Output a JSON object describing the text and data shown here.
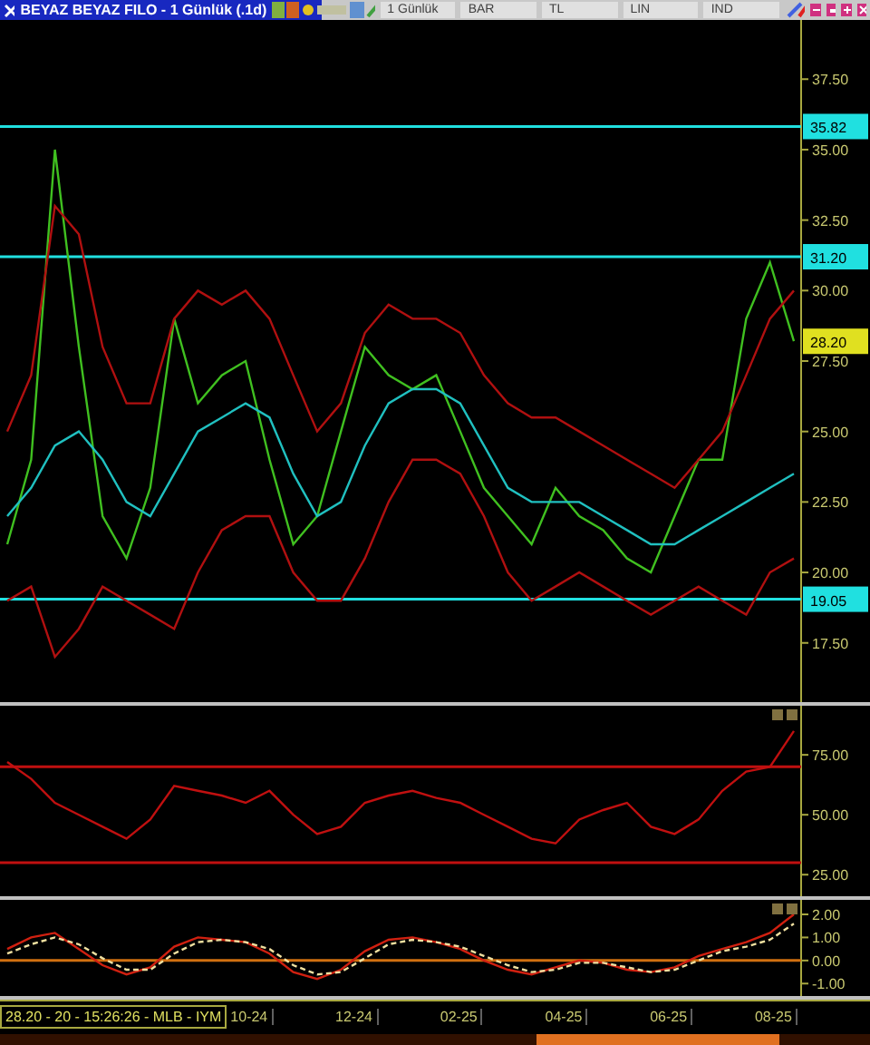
{
  "window": {
    "title": "BEYAZ BEYAZ FILO - 1 Günlük (.1d)"
  },
  "toolbar": [
    "1 Günlük",
    "BAR",
    "TL",
    "LIN",
    "IND"
  ],
  "panels": [
    {
      "chart_data": {
        "type": "line",
        "ylim": [
          15.4,
          39.6
        ],
        "yticks": [
          {
            "value": 17.5,
            "label": "17.50"
          },
          {
            "value": 20,
            "label": "20.00"
          },
          {
            "value": 22.5,
            "label": "22.50"
          },
          {
            "value": 25,
            "label": "25.00"
          },
          {
            "value": 27.5,
            "label": "27.50"
          },
          {
            "value": 30,
            "label": "30.00"
          },
          {
            "value": 32.5,
            "label": "32.50"
          },
          {
            "value": 35,
            "label": "35.00"
          },
          {
            "value": 37.5,
            "label": "37.50"
          }
        ],
        "series": [
          {
            "color": "#40c020",
            "values": [
              21,
              24,
              35,
              28,
              22,
              20.5,
              23,
              29,
              26,
              27,
              27.5,
              24,
              21,
              22,
              25,
              28,
              27,
              26.5,
              27,
              25,
              23,
              22,
              21,
              23,
              22,
              21.5,
              20.5,
              20,
              22,
              24,
              24,
              29,
              31,
              28.2
            ]
          },
          {
            "color": "#b01010",
            "values": [
              25,
              27,
              33,
              32,
              28,
              26,
              26,
              29,
              30,
              29.5,
              30,
              29,
              27,
              25,
              26,
              28.5,
              29.5,
              29,
              29,
              28.5,
              27,
              26,
              25.5,
              25.5,
              25,
              24.5,
              24,
              23.5,
              23,
              24,
              25,
              27,
              29,
              30
            ]
          },
          {
            "color": "#b01010",
            "values": [
              19,
              19.5,
              17,
              18,
              19.5,
              19,
              18.5,
              18,
              20,
              21.5,
              22,
              22,
              20,
              19,
              19,
              20.5,
              22.5,
              24,
              24,
              23.5,
              22,
              20,
              19,
              19.5,
              20,
              19.5,
              19,
              18.5,
              19,
              19.5,
              19,
              18.5,
              20,
              20.5
            ]
          },
          {
            "color": "#20c0c0",
            "values": [
              22,
              23,
              24.5,
              25,
              24,
              22.5,
              22,
              23.5,
              25,
              25.5,
              26,
              25.5,
              23.5,
              22,
              22.5,
              24.5,
              26,
              26.5,
              26.5,
              26,
              24.5,
              23,
              22.5,
              22.5,
              22.5,
              22,
              21.5,
              21,
              21,
              21.5,
              22,
              22.5,
              23,
              23.5
            ]
          }
        ],
        "ref_lines": [
          {
            "axis": "y",
            "value": 35.82,
            "label": "35.82"
          },
          {
            "axis": "y",
            "value": 31.2,
            "label": "31.20"
          },
          {
            "axis": "y",
            "value": 19.05,
            "label": "19.05"
          }
        ],
        "annotations": [
          "28.20"
        ]
      }
    },
    {
      "chart_data": {
        "type": "line",
        "ylim": [
          16,
          95.5
        ],
        "yticks": [
          {
            "value": 25,
            "label": "25.00"
          },
          {
            "value": 50,
            "label": "50.00"
          },
          {
            "value": 75,
            "label": "75.00"
          }
        ],
        "series": [
          {
            "color": "#c01010",
            "values": [
              72,
              65,
              55,
              50,
              45,
              40,
              48,
              62,
              60,
              58,
              55,
              60,
              50,
              42,
              45,
              55,
              58,
              60,
              57,
              55,
              50,
              45,
              40,
              38,
              48,
              52,
              55,
              45,
              42,
              48,
              60,
              68,
              70,
              85
            ]
          }
        ],
        "ref_lines": [
          {
            "axis": "y",
            "value": 70
          },
          {
            "axis": "y",
            "value": 30
          }
        ]
      }
    },
    {
      "chart_data": {
        "type": "line",
        "ylim": [
          -1.54,
          2.63
        ],
        "yticks": [
          {
            "value": -1,
            "label": "-1.00"
          },
          {
            "value": 0,
            "label": "0.00"
          },
          {
            "value": 1,
            "label": "1.00"
          },
          {
            "value": 2,
            "label": "2.00"
          }
        ],
        "series": [
          {
            "color": "#d02010",
            "values": [
              0.5,
              1,
              1.2,
              0.5,
              -0.2,
              -0.6,
              -0.3,
              0.6,
              1,
              0.9,
              0.8,
              0.3,
              -0.5,
              -0.8,
              -0.4,
              0.4,
              0.9,
              1,
              0.8,
              0.5,
              0,
              -0.4,
              -0.6,
              -0.3,
              0,
              -0.1,
              -0.4,
              -0.5,
              -0.3,
              0.2,
              0.5,
              0.8,
              1.2,
              2
            ]
          },
          {
            "color": "#f0e0a0",
            "line_style": "dashed",
            "values": [
              0.3,
              0.7,
              1,
              0.7,
              0.1,
              -0.4,
              -0.4,
              0.3,
              0.8,
              0.9,
              0.8,
              0.5,
              -0.2,
              -0.6,
              -0.5,
              0.1,
              0.7,
              0.9,
              0.8,
              0.6,
              0.2,
              -0.2,
              -0.5,
              -0.4,
              -0.1,
              -0.1,
              -0.3,
              -0.5,
              -0.4,
              0,
              0.4,
              0.6,
              0.9,
              1.6
            ]
          }
        ],
        "ref_lines": [
          {
            "axis": "y",
            "value": 0
          }
        ]
      }
    }
  ],
  "status": "28.20 - 20 - 15:26:26 - MLB - IYM",
  "xaxis_labels": [
    "10-24",
    "12-24",
    "02-25",
    "04-25",
    "06-25",
    "08-25"
  ]
}
